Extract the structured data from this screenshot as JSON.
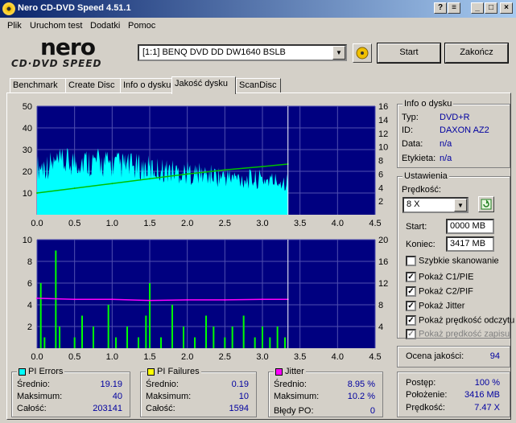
{
  "window": {
    "title": "Nero CD-DVD Speed 4.51.1"
  },
  "menu": [
    "Plik",
    "Uruchom test",
    "Dodatki",
    "Pomoc"
  ],
  "logo": {
    "top": "nero",
    "bottom": "CD·DVD SPEED"
  },
  "drive": {
    "selected": "[1:1]  BENQ DVD DD DW1640 BSLB"
  },
  "buttons": {
    "start": "Start",
    "exit": "Zakończ"
  },
  "tabs": [
    "Benchmark",
    "Create Disc",
    "Info o dysku",
    "Jakość dysku",
    "ScanDisc"
  ],
  "active_tab": 3,
  "disc_info": {
    "title": "Info o dysku",
    "rows": [
      {
        "label": "Typ:",
        "value": "DVD+R"
      },
      {
        "label": "ID:",
        "value": "DAXON AZ2"
      },
      {
        "label": "Data:",
        "value": "n/a"
      },
      {
        "label": "Etykieta:",
        "value": "n/a"
      }
    ]
  },
  "settings": {
    "title": "Ustawienia",
    "speed_label": "Prędkość:",
    "speed_value": "8 X",
    "start_label": "Start:",
    "start_value": "0000 MB",
    "end_label": "Koniec:",
    "end_value": "3417 MB",
    "checks": [
      {
        "label": "Szybkie skanowanie",
        "checked": false,
        "enabled": true
      },
      {
        "label": "Pokaż C1/PIE",
        "checked": true,
        "enabled": true
      },
      {
        "label": "Pokaż C2/PIF",
        "checked": true,
        "enabled": true
      },
      {
        "label": "Pokaż Jitter",
        "checked": true,
        "enabled": true
      },
      {
        "label": "Pokaż prędkość odczytu",
        "checked": true,
        "enabled": true
      },
      {
        "label": "Pokaż prędkość zapisu",
        "checked": true,
        "enabled": false
      }
    ]
  },
  "quality": {
    "label": "Ocena jakości:",
    "value": "94"
  },
  "pi_errors": {
    "title": "PI Errors",
    "color": "#00ffff",
    "rows": [
      {
        "label": "Średnio:",
        "value": "19.19"
      },
      {
        "label": "Maksimum:",
        "value": "40"
      },
      {
        "label": "Całość:",
        "value": "203141"
      }
    ]
  },
  "pi_failures": {
    "title": "PI Failures",
    "color": "#ffff00",
    "rows": [
      {
        "label": "Średnio:",
        "value": "0.19"
      },
      {
        "label": "Maksimum:",
        "value": "10"
      },
      {
        "label": "Całość:",
        "value": "1594"
      }
    ]
  },
  "jitter": {
    "title": "Jitter",
    "color": "#ff00ff",
    "rows": [
      {
        "label": "Średnio:",
        "value": "8.95 %"
      },
      {
        "label": "Maksimum:",
        "value": "10.2 %"
      },
      {
        "label": "Błędy PO:",
        "value": "0"
      }
    ]
  },
  "progress": {
    "rows": [
      {
        "label": "Postęp:",
        "value": "100 %"
      },
      {
        "label": "Położenie:",
        "value": "3416 MB"
      },
      {
        "label": "Prędkość:",
        "value": "7.47 X"
      }
    ]
  },
  "chart_data": [
    {
      "type": "area",
      "xlim": [
        0,
        4.5
      ],
      "x_ticks": [
        "0.0",
        "0.5",
        "1.0",
        "1.5",
        "2.0",
        "2.5",
        "3.0",
        "3.5",
        "4.0",
        "4.5"
      ],
      "ylim_left": [
        0,
        50
      ],
      "y_ticks_left": [
        "10",
        "20",
        "30",
        "40",
        "50"
      ],
      "ylim_right": [
        0,
        16
      ],
      "y_ticks_right": [
        "2",
        "4",
        "6",
        "8",
        "10",
        "12",
        "14",
        "16"
      ],
      "series": [
        {
          "color": "#00ffff",
          "x": [
            0.0,
            0.2,
            0.4,
            0.6,
            0.8,
            1.0,
            1.2,
            1.4,
            1.6,
            1.8,
            2.0,
            2.2,
            2.4,
            2.6,
            2.8,
            3.0,
            3.2,
            3.34
          ],
          "values": [
            28,
            30,
            31,
            32,
            31,
            30,
            29,
            28,
            27,
            26,
            25,
            24,
            23,
            22,
            21,
            21,
            20,
            20
          ]
        },
        {
          "color": "#00c000",
          "axis": "right",
          "x": [
            0.0,
            0.5,
            1.0,
            1.5,
            2.0,
            2.5,
            3.0,
            3.34
          ],
          "values": [
            3.2,
            3.9,
            4.6,
            5.3,
            6.0,
            6.6,
            7.1,
            7.47
          ]
        }
      ],
      "end_marker": 3.34
    },
    {
      "type": "bar",
      "xlim": [
        0,
        4.5
      ],
      "x_ticks": [
        "0.0",
        "0.5",
        "1.0",
        "1.5",
        "2.0",
        "2.5",
        "3.0",
        "3.5",
        "4.0",
        "4.5"
      ],
      "ylim_left": [
        0,
        10
      ],
      "y_ticks_left": [
        "2",
        "4",
        "6",
        "8",
        "10"
      ],
      "ylim_right": [
        0,
        20
      ],
      "y_ticks_right": [
        "4",
        "8",
        "12",
        "16",
        "20"
      ],
      "series": [
        {
          "color": "#00ff00",
          "x": [
            0.05,
            0.1,
            0.25,
            0.3,
            0.5,
            0.6,
            0.75,
            0.95,
            1.05,
            1.2,
            1.35,
            1.45,
            1.5,
            1.65,
            1.8,
            1.95,
            2.1,
            2.25,
            2.35,
            2.5,
            2.6,
            2.75,
            2.9,
            3.0,
            3.1,
            3.2,
            3.3
          ],
          "values": [
            6,
            1,
            9,
            2,
            1,
            3,
            2,
            4,
            1,
            2,
            1,
            3,
            6,
            1,
            4,
            2,
            1,
            3,
            2,
            1,
            2,
            3,
            1,
            2,
            1,
            2,
            1
          ]
        },
        {
          "color": "#ff00ff",
          "axis": "right",
          "x": [
            0.0,
            0.5,
            1.0,
            1.5,
            2.0,
            2.5,
            3.0,
            3.34
          ],
          "values": [
            9.2,
            9.0,
            9.0,
            8.8,
            8.9,
            8.9,
            9.0,
            9.0
          ]
        }
      ],
      "end_marker": 3.34
    }
  ]
}
